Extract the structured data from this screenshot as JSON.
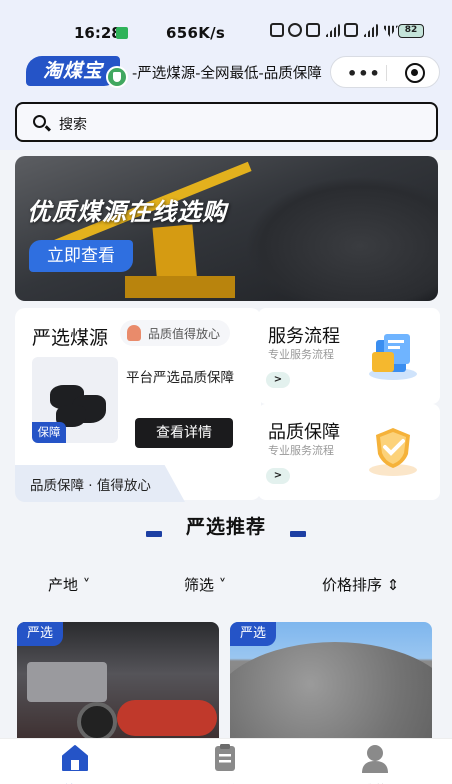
{
  "status_bar": {
    "time": "16:28",
    "network_speed": "656K/s",
    "battery": "82"
  },
  "nav": {
    "logo_text": "淘煤宝",
    "title": "-严选煤源-全网最低-品质保障"
  },
  "search": {
    "placeholder": "搜索"
  },
  "banner": {
    "title": "优质煤源在线选购",
    "button_label": "立即查看"
  },
  "feature_main": {
    "title": "严选煤源",
    "badge": "品质值得放心",
    "description": "平台严选品质保障",
    "tag": "保障",
    "button_label": "查看详情",
    "footer": "品质保障 · 值得放心"
  },
  "feature_side": [
    {
      "title": "服务流程",
      "subtitle": "专业服务流程",
      "arrow": ">",
      "icon": "document-folder-icon"
    },
    {
      "title": "品质保障",
      "subtitle": "专业服务流程",
      "arrow": ">",
      "icon": "shield-check-icon"
    }
  ],
  "section": {
    "title": "严选推荐"
  },
  "filters": [
    {
      "label": "产地 ˅"
    },
    {
      "label": "筛选 ˅"
    },
    {
      "label": "价格排序 ⇕"
    }
  ],
  "products": [
    {
      "tag": "严选",
      "image": "machinery-photo"
    },
    {
      "tag": "严选",
      "image": "coal-pile-photo"
    }
  ],
  "tabs": [
    {
      "label": "首页",
      "icon": "home-icon",
      "active": true
    },
    {
      "label": "订单",
      "icon": "order-icon",
      "active": false
    },
    {
      "label": "我的",
      "icon": "user-icon",
      "active": false
    }
  ],
  "colors": {
    "brand_blue": "#2554c7",
    "header_bg": "#ecf0fb",
    "page_bg": "#f2f4f8"
  }
}
